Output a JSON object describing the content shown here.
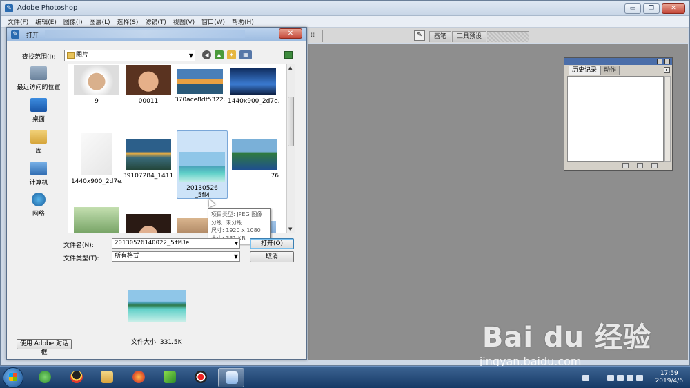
{
  "app": {
    "title": "Adobe Photoshop"
  },
  "menubar": [
    "文件(F)",
    "编辑(E)",
    "图像(I)",
    "图层(L)",
    "选择(S)",
    "滤镜(T)",
    "视图(V)",
    "窗口(W)",
    "帮助(H)"
  ],
  "window_controls": {
    "minimize": "▭",
    "restore": "❐",
    "close": "✕"
  },
  "options_bar": {
    "tabs": [
      "画笔",
      "工具预设"
    ]
  },
  "history_panel": {
    "tabs": [
      "历史记录",
      "动作"
    ]
  },
  "dialog": {
    "title": "打开",
    "look_in_label": "查找范围(I):",
    "look_in_value": "图片",
    "places": [
      {
        "label": "最近访问的位置",
        "icon": "recent-places-icon"
      },
      {
        "label": "桌面",
        "icon": "desktop-icon"
      },
      {
        "label": "库",
        "icon": "libraries-icon"
      },
      {
        "label": "计算机",
        "icon": "computer-icon"
      },
      {
        "label": "网络",
        "icon": "network-icon"
      }
    ],
    "files": [
      {
        "label": "9"
      },
      {
        "label": "00011"
      },
      {
        "label": "370ace8df5322..."
      },
      {
        "label": "1440x900_2d7e..."
      },
      {
        "label": "1440x900_2d7e..."
      },
      {
        "label": "39107284_1411..."
      },
      {
        "label": "20130526",
        "label2": "_5fM"
      },
      {
        "label": "76"
      },
      {
        "label": ""
      },
      {
        "label": ""
      },
      {
        "label": ""
      },
      {
        "label": ""
      }
    ],
    "tooltip": {
      "type": "项目类型: JPEG 图像",
      "rating": "分级: 未分级",
      "dimensions": "尺寸: 1920 x 1080",
      "size": "大小: 331 KB"
    },
    "filename_label": "文件名(N):",
    "filename_value": "20130526140022_5fMJe",
    "filetype_label": "文件类型(T):",
    "filetype_value": "所有格式",
    "open_button": "打开(O)",
    "cancel_button": "取消",
    "file_size_text": "文件大小: 331.5K",
    "adobe_dialog_button": "使用 Adobe 对话框"
  },
  "taskbar": {
    "time": "17:59",
    "date": "2019/4/6"
  },
  "watermark": {
    "main": "Bai du 经验",
    "sub": "jingyan.baidu.com"
  }
}
